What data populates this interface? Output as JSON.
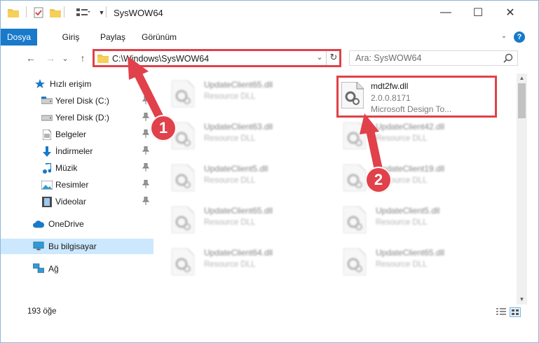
{
  "window": {
    "title": "SysWOW64",
    "minimize": "—",
    "maximize": "☐",
    "close": "✕"
  },
  "ribbon": {
    "tabs": [
      {
        "label": "Dosya",
        "active": true
      },
      {
        "label": "Giriş",
        "active": false
      },
      {
        "label": "Paylaş",
        "active": false
      },
      {
        "label": "Görünüm",
        "active": false
      }
    ],
    "collapse_icon": "chevron-down-icon",
    "help_icon": "help-icon"
  },
  "nav": {
    "back": "←",
    "forward": "→",
    "recent": "⌄",
    "up": "↑",
    "address_path": "C:\\Windows\\SysWOW64",
    "dropdown": "⌄",
    "refresh": "↻",
    "search_placeholder": "Ara: SysWOW64"
  },
  "sidebar": {
    "items": [
      {
        "label": "Hızlı erişim",
        "icon": "star-icon",
        "pinned": false
      },
      {
        "label": "Yerel Disk (C:)",
        "icon": "drive-icon",
        "pinned": true
      },
      {
        "label": "Yerel Disk (D:)",
        "icon": "drive-icon",
        "pinned": true
      },
      {
        "label": "Belgeler",
        "icon": "documents-icon",
        "pinned": true
      },
      {
        "label": "İndirmeler",
        "icon": "download-icon",
        "pinned": true
      },
      {
        "label": "Müzik",
        "icon": "music-icon",
        "pinned": true
      },
      {
        "label": "Resimler",
        "icon": "pictures-icon",
        "pinned": true
      },
      {
        "label": "Videolar",
        "icon": "videos-icon",
        "pinned": true
      },
      {
        "label": "OneDrive",
        "icon": "cloud-icon",
        "pinned": false
      },
      {
        "label": "Bu bilgisayar",
        "icon": "computer-icon",
        "pinned": false,
        "selected": true
      },
      {
        "label": "Ağ",
        "icon": "network-icon",
        "pinned": false
      }
    ]
  },
  "files": {
    "highlighted": {
      "name": "mdt2fw.dll",
      "version": "2.0.0.8171",
      "description": "Microsoft Design To..."
    },
    "left_column": [
      {
        "name": "UpdateClient65.dll",
        "desc": "Resource DLL"
      },
      {
        "name": "UpdateClient63.dll",
        "desc": "Resource DLL"
      },
      {
        "name": "UpdateClient5.dll",
        "desc": "Resource DLL"
      },
      {
        "name": "UpdateClient65.dll",
        "desc": "Resource DLL"
      },
      {
        "name": "UpdateClient64.dll",
        "desc": "Resource DLL"
      }
    ],
    "right_column": [
      {
        "name": "UpdateClient42.dll",
        "desc": "Resource DLL"
      },
      {
        "name": "UpdateClient19.dll",
        "desc": "Resource DLL"
      },
      {
        "name": "UpdateClient5.dll",
        "desc": "Resource DLL"
      },
      {
        "name": "UpdateClient65.dll",
        "desc": "Resource DLL"
      }
    ]
  },
  "status": {
    "count": "193 öğe"
  },
  "annotations": {
    "step1": "1",
    "step2": "2"
  },
  "colors": {
    "accent": "#1979ca",
    "annotation_red": "#e0414a",
    "selection": "#cce8ff",
    "folder": "#f0c44c"
  }
}
